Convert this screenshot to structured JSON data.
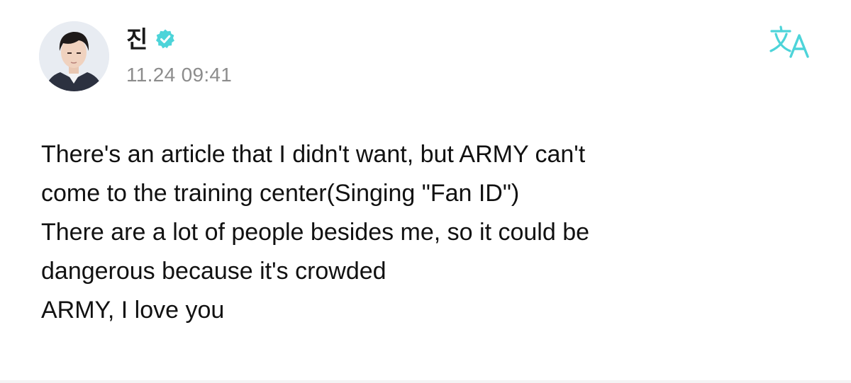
{
  "post": {
    "author": {
      "name": "진",
      "verified": true,
      "badge_icon": "verified-check-icon",
      "badge_color": "#4dd4d9"
    },
    "timestamp": "11.24 09:41",
    "translate_icon": "translate-icon",
    "accent_color": "#4dd4d9",
    "body_lines": [
      "There's an article that I didn't want, but ARMY can't",
      "come to the training center(Singing \"Fan ID\")",
      "There are a lot of people besides me, so it could be",
      "dangerous because it's crowded",
      "ARMY, I love you"
    ]
  }
}
